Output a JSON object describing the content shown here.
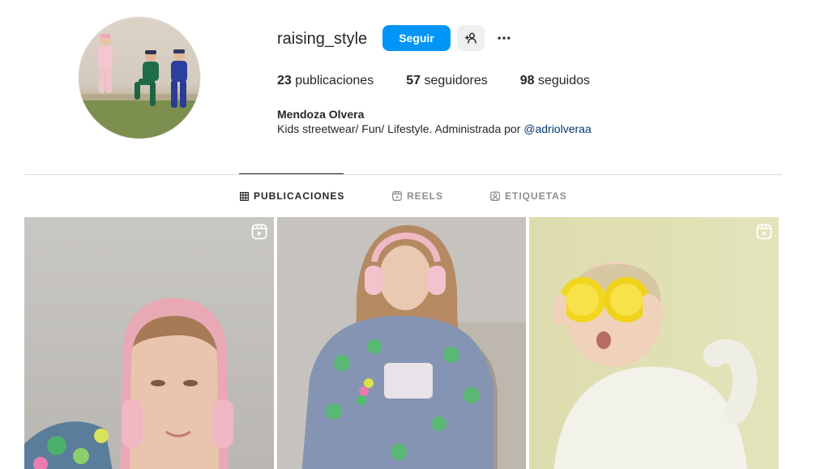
{
  "profile": {
    "username": "raising_style",
    "follow_label": "Seguir",
    "full_name": "Mendoza Olvera",
    "bio_text": "Kids streetwear/ Fun/ Lifestyle. Administrada por ",
    "bio_mention": "@adriolveraa",
    "avatar_icon": "profile-photo"
  },
  "stats": {
    "posts_count": "23",
    "posts_label": "publicaciones",
    "followers_count": "57",
    "followers_label": "seguidores",
    "following_count": "98",
    "following_label": "seguidos"
  },
  "tabs": [
    {
      "label": "PUBLICACIONES",
      "icon": "grid-icon",
      "active": true
    },
    {
      "label": "REELS",
      "icon": "reels-icon",
      "active": false
    },
    {
      "label": "ETIQUETAS",
      "icon": "tag-icon",
      "active": false
    }
  ],
  "posts": [
    {
      "type": "reel",
      "badge_icon": "reels-icon"
    },
    {
      "type": "photo"
    },
    {
      "type": "reel",
      "badge_icon": "reels-icon"
    }
  ],
  "colors": {
    "accent": "#0095f6",
    "text": "#262626",
    "muted": "#8e8e8e",
    "link": "#00376b",
    "divider": "#dbdbdb"
  }
}
